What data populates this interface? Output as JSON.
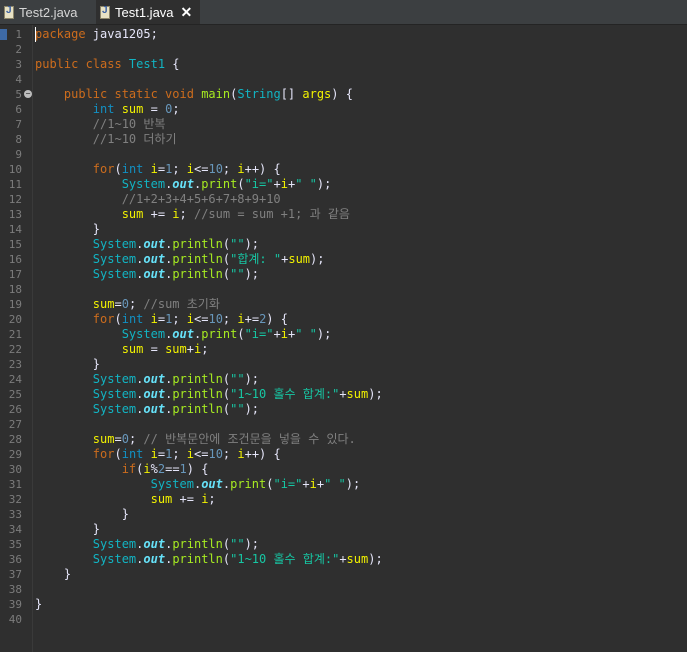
{
  "tabs": [
    {
      "label": "Test2.java",
      "active": false
    },
    {
      "label": "Test1.java",
      "active": true
    }
  ],
  "colors": {
    "background": "#2f2f2f",
    "keyword": "#cc6c1d",
    "string": "#17c6a3",
    "comment": "#808080",
    "number": "#6897bb",
    "method": "#a7ec21"
  },
  "editor": {
    "line_count": 40,
    "lines": [
      [
        [
          "kw",
          "package"
        ],
        [
          "op",
          " java1205;"
        ]
      ],
      [],
      [
        [
          "kw",
          "public class "
        ],
        [
          "cls",
          "Test1"
        ],
        [
          "op",
          " {"
        ]
      ],
      [],
      [
        [
          "op",
          "    "
        ],
        [
          "kw",
          "public static void "
        ],
        [
          "fn",
          "main"
        ],
        [
          "op",
          "("
        ],
        [
          "cls",
          "String"
        ],
        [
          "op",
          "[] "
        ],
        [
          "var",
          "args"
        ],
        [
          "op",
          ") {"
        ]
      ],
      [
        [
          "op",
          "        "
        ],
        [
          "typ",
          "int "
        ],
        [
          "var",
          "sum"
        ],
        [
          "op",
          " = "
        ],
        [
          "num",
          "0"
        ],
        [
          "op",
          ";"
        ]
      ],
      [
        [
          "op",
          "        "
        ],
        [
          "cmt",
          "//1~10 반복"
        ]
      ],
      [
        [
          "op",
          "        "
        ],
        [
          "cmt",
          "//1~10 더하기"
        ]
      ],
      [],
      [
        [
          "op",
          "        "
        ],
        [
          "kw",
          "for"
        ],
        [
          "op",
          "("
        ],
        [
          "typ",
          "int "
        ],
        [
          "var",
          "i"
        ],
        [
          "op",
          "="
        ],
        [
          "num",
          "1"
        ],
        [
          "op",
          "; "
        ],
        [
          "var",
          "i"
        ],
        [
          "op",
          "<="
        ],
        [
          "num",
          "10"
        ],
        [
          "op",
          "; "
        ],
        [
          "var",
          "i"
        ],
        [
          "op",
          "++) {"
        ]
      ],
      [
        [
          "op",
          "            "
        ],
        [
          "cls",
          "System"
        ],
        [
          "op",
          "."
        ],
        [
          "fld",
          "out"
        ],
        [
          "op",
          "."
        ],
        [
          "fn",
          "print"
        ],
        [
          "op",
          "("
        ],
        [
          "str",
          "\"i=\""
        ],
        [
          "op",
          "+"
        ],
        [
          "var",
          "i"
        ],
        [
          "op",
          "+"
        ],
        [
          "str",
          "\" \""
        ],
        [
          "op",
          ");"
        ]
      ],
      [
        [
          "op",
          "            "
        ],
        [
          "cmt",
          "//1+2+3+4+5+6+7+8+9+10"
        ]
      ],
      [
        [
          "op",
          "            "
        ],
        [
          "var",
          "sum"
        ],
        [
          "op",
          " += "
        ],
        [
          "var",
          "i"
        ],
        [
          "op",
          "; "
        ],
        [
          "cmt",
          "//sum = sum +1; 과 같음"
        ]
      ],
      [
        [
          "op",
          "        }"
        ]
      ],
      [
        [
          "op",
          "        "
        ],
        [
          "cls",
          "System"
        ],
        [
          "op",
          "."
        ],
        [
          "fld",
          "out"
        ],
        [
          "op",
          "."
        ],
        [
          "fn",
          "println"
        ],
        [
          "op",
          "("
        ],
        [
          "str",
          "\"\""
        ],
        [
          "op",
          ");"
        ]
      ],
      [
        [
          "op",
          "        "
        ],
        [
          "cls",
          "System"
        ],
        [
          "op",
          "."
        ],
        [
          "fld",
          "out"
        ],
        [
          "op",
          "."
        ],
        [
          "fn",
          "println"
        ],
        [
          "op",
          "("
        ],
        [
          "str",
          "\"합계: \""
        ],
        [
          "op",
          "+"
        ],
        [
          "var",
          "sum"
        ],
        [
          "op",
          ");"
        ]
      ],
      [
        [
          "op",
          "        "
        ],
        [
          "cls",
          "System"
        ],
        [
          "op",
          "."
        ],
        [
          "fld",
          "out"
        ],
        [
          "op",
          "."
        ],
        [
          "fn",
          "println"
        ],
        [
          "op",
          "("
        ],
        [
          "str",
          "\"\""
        ],
        [
          "op",
          ");"
        ]
      ],
      [],
      [
        [
          "op",
          "        "
        ],
        [
          "var",
          "sum"
        ],
        [
          "op",
          "="
        ],
        [
          "num",
          "0"
        ],
        [
          "op",
          "; "
        ],
        [
          "cmt",
          "//sum 초기화"
        ]
      ],
      [
        [
          "op",
          "        "
        ],
        [
          "kw",
          "for"
        ],
        [
          "op",
          "("
        ],
        [
          "typ",
          "int "
        ],
        [
          "var",
          "i"
        ],
        [
          "op",
          "="
        ],
        [
          "num",
          "1"
        ],
        [
          "op",
          "; "
        ],
        [
          "var",
          "i"
        ],
        [
          "op",
          "<="
        ],
        [
          "num",
          "10"
        ],
        [
          "op",
          "; "
        ],
        [
          "var",
          "i"
        ],
        [
          "op",
          "+="
        ],
        [
          "num",
          "2"
        ],
        [
          "op",
          ") {"
        ]
      ],
      [
        [
          "op",
          "            "
        ],
        [
          "cls",
          "System"
        ],
        [
          "op",
          "."
        ],
        [
          "fld",
          "out"
        ],
        [
          "op",
          "."
        ],
        [
          "fn",
          "print"
        ],
        [
          "op",
          "("
        ],
        [
          "str",
          "\"i=\""
        ],
        [
          "op",
          "+"
        ],
        [
          "var",
          "i"
        ],
        [
          "op",
          "+"
        ],
        [
          "str",
          "\" \""
        ],
        [
          "op",
          ");"
        ]
      ],
      [
        [
          "op",
          "            "
        ],
        [
          "var",
          "sum"
        ],
        [
          "op",
          " = "
        ],
        [
          "var",
          "sum"
        ],
        [
          "op",
          "+"
        ],
        [
          "var",
          "i"
        ],
        [
          "op",
          ";"
        ]
      ],
      [
        [
          "op",
          "        }"
        ]
      ],
      [
        [
          "op",
          "        "
        ],
        [
          "cls",
          "System"
        ],
        [
          "op",
          "."
        ],
        [
          "fld",
          "out"
        ],
        [
          "op",
          "."
        ],
        [
          "fn",
          "println"
        ],
        [
          "op",
          "("
        ],
        [
          "str",
          "\"\""
        ],
        [
          "op",
          ");"
        ]
      ],
      [
        [
          "op",
          "        "
        ],
        [
          "cls",
          "System"
        ],
        [
          "op",
          "."
        ],
        [
          "fld",
          "out"
        ],
        [
          "op",
          "."
        ],
        [
          "fn",
          "println"
        ],
        [
          "op",
          "("
        ],
        [
          "str",
          "\"1~10 홀수 합계:\""
        ],
        [
          "op",
          "+"
        ],
        [
          "var",
          "sum"
        ],
        [
          "op",
          ");"
        ]
      ],
      [
        [
          "op",
          "        "
        ],
        [
          "cls",
          "System"
        ],
        [
          "op",
          "."
        ],
        [
          "fld",
          "out"
        ],
        [
          "op",
          "."
        ],
        [
          "fn",
          "println"
        ],
        [
          "op",
          "("
        ],
        [
          "str",
          "\"\""
        ],
        [
          "op",
          ");"
        ]
      ],
      [],
      [
        [
          "op",
          "        "
        ],
        [
          "var",
          "sum"
        ],
        [
          "op",
          "="
        ],
        [
          "num",
          "0"
        ],
        [
          "op",
          "; "
        ],
        [
          "cmt",
          "// 반복문안에 조건문을 넣을 수 있다."
        ]
      ],
      [
        [
          "op",
          "        "
        ],
        [
          "kw",
          "for"
        ],
        [
          "op",
          "("
        ],
        [
          "typ",
          "int "
        ],
        [
          "var",
          "i"
        ],
        [
          "op",
          "="
        ],
        [
          "num",
          "1"
        ],
        [
          "op",
          "; "
        ],
        [
          "var",
          "i"
        ],
        [
          "op",
          "<="
        ],
        [
          "num",
          "10"
        ],
        [
          "op",
          "; "
        ],
        [
          "var",
          "i"
        ],
        [
          "op",
          "++) {"
        ]
      ],
      [
        [
          "op",
          "            "
        ],
        [
          "kw",
          "if"
        ],
        [
          "op",
          "("
        ],
        [
          "var",
          "i"
        ],
        [
          "op",
          "%"
        ],
        [
          "num",
          "2"
        ],
        [
          "op",
          "=="
        ],
        [
          "num",
          "1"
        ],
        [
          "op",
          ") {"
        ]
      ],
      [
        [
          "op",
          "                "
        ],
        [
          "cls",
          "System"
        ],
        [
          "op",
          "."
        ],
        [
          "fld",
          "out"
        ],
        [
          "op",
          "."
        ],
        [
          "fn",
          "print"
        ],
        [
          "op",
          "("
        ],
        [
          "str",
          "\"i=\""
        ],
        [
          "op",
          "+"
        ],
        [
          "var",
          "i"
        ],
        [
          "op",
          "+"
        ],
        [
          "str",
          "\" \""
        ],
        [
          "op",
          ");"
        ]
      ],
      [
        [
          "op",
          "                "
        ],
        [
          "var",
          "sum"
        ],
        [
          "op",
          " += "
        ],
        [
          "var",
          "i"
        ],
        [
          "op",
          ";"
        ]
      ],
      [
        [
          "op",
          "            }"
        ]
      ],
      [
        [
          "op",
          "        }"
        ]
      ],
      [
        [
          "op",
          "        "
        ],
        [
          "cls",
          "System"
        ],
        [
          "op",
          "."
        ],
        [
          "fld",
          "out"
        ],
        [
          "op",
          "."
        ],
        [
          "fn",
          "println"
        ],
        [
          "op",
          "("
        ],
        [
          "str",
          "\"\""
        ],
        [
          "op",
          ");"
        ]
      ],
      [
        [
          "op",
          "        "
        ],
        [
          "cls",
          "System"
        ],
        [
          "op",
          "."
        ],
        [
          "fld",
          "out"
        ],
        [
          "op",
          "."
        ],
        [
          "fn",
          "println"
        ],
        [
          "op",
          "("
        ],
        [
          "str",
          "\"1~10 홀수 합계:\""
        ],
        [
          "op",
          "+"
        ],
        [
          "var",
          "sum"
        ],
        [
          "op",
          ");"
        ]
      ],
      [
        [
          "op",
          "    }"
        ]
      ],
      [],
      [
        [
          "op",
          "}"
        ]
      ],
      []
    ]
  }
}
